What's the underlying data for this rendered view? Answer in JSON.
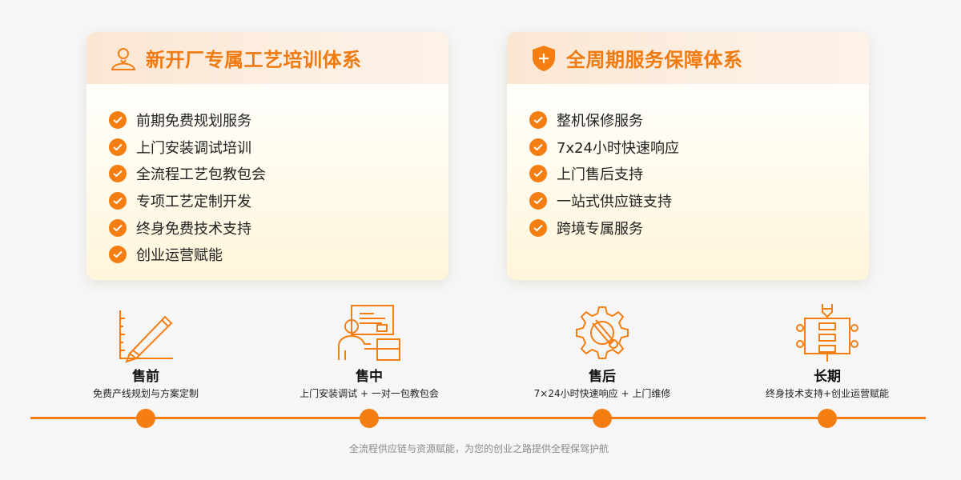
{
  "training_card": {
    "title": "新开厂专属工艺培训体系",
    "icon": "person-icon",
    "items": [
      "前期免费规划服务",
      "上门安装调试培训",
      "全流程工艺包教包会",
      "专项工艺定制开发",
      "终身免费技术支持",
      "创业运营赋能"
    ]
  },
  "service_card": {
    "title": "全周期服务保障体系",
    "icon": "shield-plus-icon",
    "items": [
      "整机保修服务",
      "7x24小时快速响应",
      "上门售后支持",
      "一站式供应链支持",
      "跨境专属服务"
    ]
  },
  "stages": [
    {
      "title": "售前",
      "desc": "免费产线规划与方案定制",
      "icon": "pencil-ruler-icon"
    },
    {
      "title": "售中",
      "desc": "上门安装调试 + 一对一包教包会",
      "icon": "trainer-desk-icon"
    },
    {
      "title": "售后",
      "desc": "7×24小时快速响应 + 上门维修",
      "icon": "gear-wrench-icon"
    },
    {
      "title": "长期",
      "desc": "终身技术支持+创业运营赋能",
      "icon": "flow-process-icon"
    }
  ],
  "footer": "全流程供应链与资源赋能，为您的创业之路提供全程保驾护航",
  "colors": {
    "accent": "#f57e12",
    "title": "#f07a0f",
    "header_bg": "#fbe6d2",
    "page_bg": "#f6f6f6"
  }
}
